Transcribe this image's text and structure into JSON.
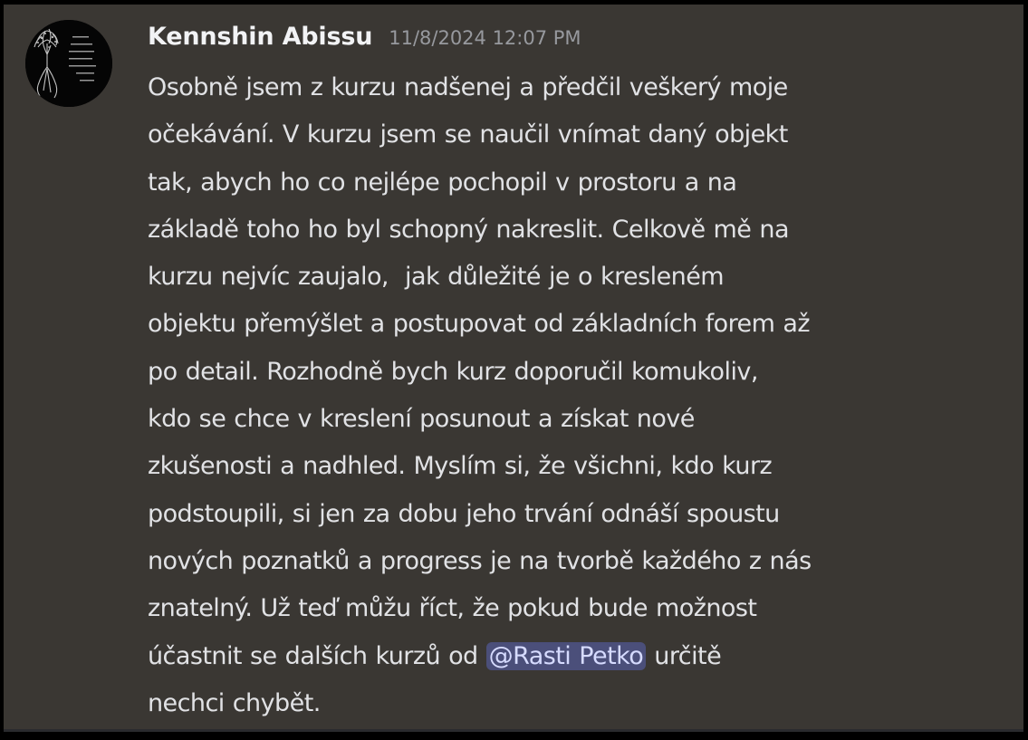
{
  "message": {
    "author": "Kennshin Abissu",
    "timestamp": "11/8/2024 12:07 PM",
    "avatar_icon": "tree-roots-avatar-icon",
    "lines": [
      "Osobně jsem z kurzu nadšenej a předčil veškerý moje",
      "očekávání. V kurzu jsem se naučil vnímat daný objekt",
      "tak, abych ho co nejlépe pochopil v prostoru a na",
      "základě toho ho byl schopný nakreslit. Celkově mě na",
      "kurzu nejvíc zaujalo,  jak důležité je o kresleném",
      "objektu přemýšlet a postupovat od základních forem až",
      "po detail. Rozhodně bych kurz doporučil komukoliv,",
      "kdo se chce v kreslení posunout a získat nové",
      "zkušenosti a nadhled. Myslím si, že všichni, kdo kurz",
      "podstoupili, si jen za dobu jeho trvání odnáší spoustu",
      "nových poznatků a progress je na tvorbě každého z nás",
      "znatelný. Už teď můžu říct, že pokud bude možnost"
    ],
    "mention_line": {
      "before": "účastnit se dalších kurzů od ",
      "mention": "@Rasti Petko",
      "after": " určitě"
    },
    "last_line": "nechci chybět."
  },
  "colors": {
    "background": "#3a3733",
    "username": "#f2f3f5",
    "timestamp": "#97999e",
    "text": "#e1e2e5",
    "mention_bg": "#4b4f7a",
    "mention_text": "#d6dbff"
  }
}
